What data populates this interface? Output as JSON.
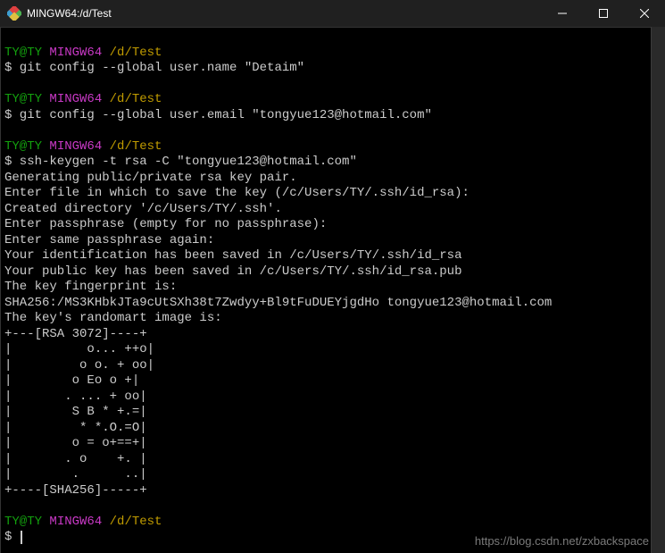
{
  "window": {
    "title": "MINGW64:/d/Test"
  },
  "prompt": {
    "userHost": "TY@TY",
    "env": "MINGW64",
    "path": "/d/Test",
    "symbol": "$"
  },
  "blocks": [
    {
      "cmd": "git config --global user.name \"Detaim\"",
      "out": []
    },
    {
      "cmd": "git config --global user.email \"tongyue123@hotmail.com\"",
      "out": []
    },
    {
      "cmd": "ssh-keygen -t rsa -C \"tongyue123@hotmail.com\"",
      "out": [
        "Generating public/private rsa key pair.",
        "Enter file in which to save the key (/c/Users/TY/.ssh/id_rsa):",
        "Created directory '/c/Users/TY/.ssh'.",
        "Enter passphrase (empty for no passphrase):",
        "Enter same passphrase again:",
        "Your identification has been saved in /c/Users/TY/.ssh/id_rsa",
        "Your public key has been saved in /c/Users/TY/.ssh/id_rsa.pub",
        "The key fingerprint is:",
        "SHA256:/MS3KHbkJTa9cUtSXh38t7Zwdyy+Bl9tFuDUEYjgdHo tongyue123@hotmail.com",
        "The key's randomart image is:",
        "+---[RSA 3072]----+",
        "|          o... ++o|",
        "|         o o. + oo|",
        "|        o Eo o +|",
        "|       . ... + oo|",
        "|        S B * +.=|",
        "|         * *.O.=O|",
        "|        o = o+==+|",
        "|       . o    +. |",
        "|        .      ..|",
        "+----[SHA256]-----+"
      ]
    }
  ],
  "watermark": "https://blog.csdn.net/zxbackspace"
}
